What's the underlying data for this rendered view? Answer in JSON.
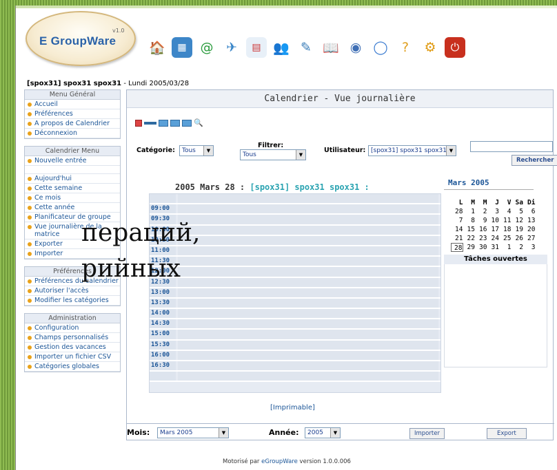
{
  "app": {
    "name": "E GroupWare",
    "version": "v1.0"
  },
  "toolbar": {
    "icons": [
      "home-icon",
      "calendar-icon",
      "email-icon",
      "news-icon",
      "tasks-icon",
      "addressbook-icon",
      "projects-icon",
      "books-icon",
      "shared-icon",
      "chat-icon",
      "help-icon",
      "infolog-icon",
      "logout-icon"
    ]
  },
  "user_line": {
    "user": "[spox31] spox31 spox31",
    "date": " - Lundi 2005/03/28"
  },
  "sidebar": {
    "general": {
      "title": "Menu Général",
      "items": [
        "Accueil",
        "Préférences",
        "A propos de Calendrier",
        "Déconnexion"
      ]
    },
    "calendar": {
      "title": "Calendrier Menu",
      "items": [
        "Nouvelle entrée",
        "",
        "Aujourd'hui",
        "Cette semaine",
        "Ce mois",
        "Cette année",
        "Planificateur de groupe",
        "Vue journalière de la matrice",
        "Exporter",
        "Importer"
      ]
    },
    "prefs": {
      "title": "Préférences",
      "items": [
        "Préférences du calendrier",
        "Autoriser l'accès",
        "Modifier les catégories"
      ]
    },
    "admin": {
      "title": "Administration",
      "items": [
        "Configuration",
        "Champs personnalisés",
        "Gestion des vacances",
        "Importer un fichier CSV",
        "Catégories globales"
      ]
    }
  },
  "main": {
    "title": "Calendrier - Vue journalière",
    "filters": {
      "category_label": "Catégorie:",
      "category_value": "Tous",
      "filter_label": "Filtrer:",
      "filter_value": "Tous",
      "user_label": "Utilisateur:",
      "user_value": "[spox31] spox31 spox31",
      "search_button": "Rechercher"
    },
    "day_header_date": "2005 Mars 28 :",
    "day_header_user": " [spox31] spox31 spox31 :",
    "times": [
      "",
      "09:00",
      "09:30",
      "10:00",
      "10:30",
      "11:00",
      "11:30",
      "12:00",
      "12:30",
      "13:00",
      "13:30",
      "14:00",
      "14:30",
      "15:00",
      "15:30",
      "16:00",
      "16:30",
      ""
    ],
    "print_link": "[Imprimable]",
    "minical": {
      "title": "Mars 2005",
      "days": [
        "L",
        "M",
        "M",
        "J",
        "V",
        "Sa",
        "Di"
      ],
      "weeks": [
        [
          "28",
          "1",
          "2",
          "3",
          "4",
          "5",
          "6"
        ],
        [
          "7",
          "8",
          "9",
          "10",
          "11",
          "12",
          "13"
        ],
        [
          "14",
          "15",
          "16",
          "17",
          "18",
          "19",
          "20"
        ],
        [
          "21",
          "22",
          "23",
          "24",
          "25",
          "26",
          "27"
        ],
        [
          "28",
          "29",
          "30",
          "31",
          "1",
          "2",
          "3"
        ]
      ]
    },
    "tasks_title": "Tâches ouvertes",
    "bottom": {
      "month_label": "Mois:",
      "month_value": "Mars 2005",
      "year_label": "Année:",
      "year_value": "2005",
      "import_button": "Importer",
      "export_button": "Export"
    }
  },
  "footer": {
    "prefix": "Motorisé par ",
    "link": "eGroupWare",
    "suffix": " version 1.0.0.006"
  },
  "overlay": {
    "line1": "пераций,",
    "line2": "рийных"
  }
}
